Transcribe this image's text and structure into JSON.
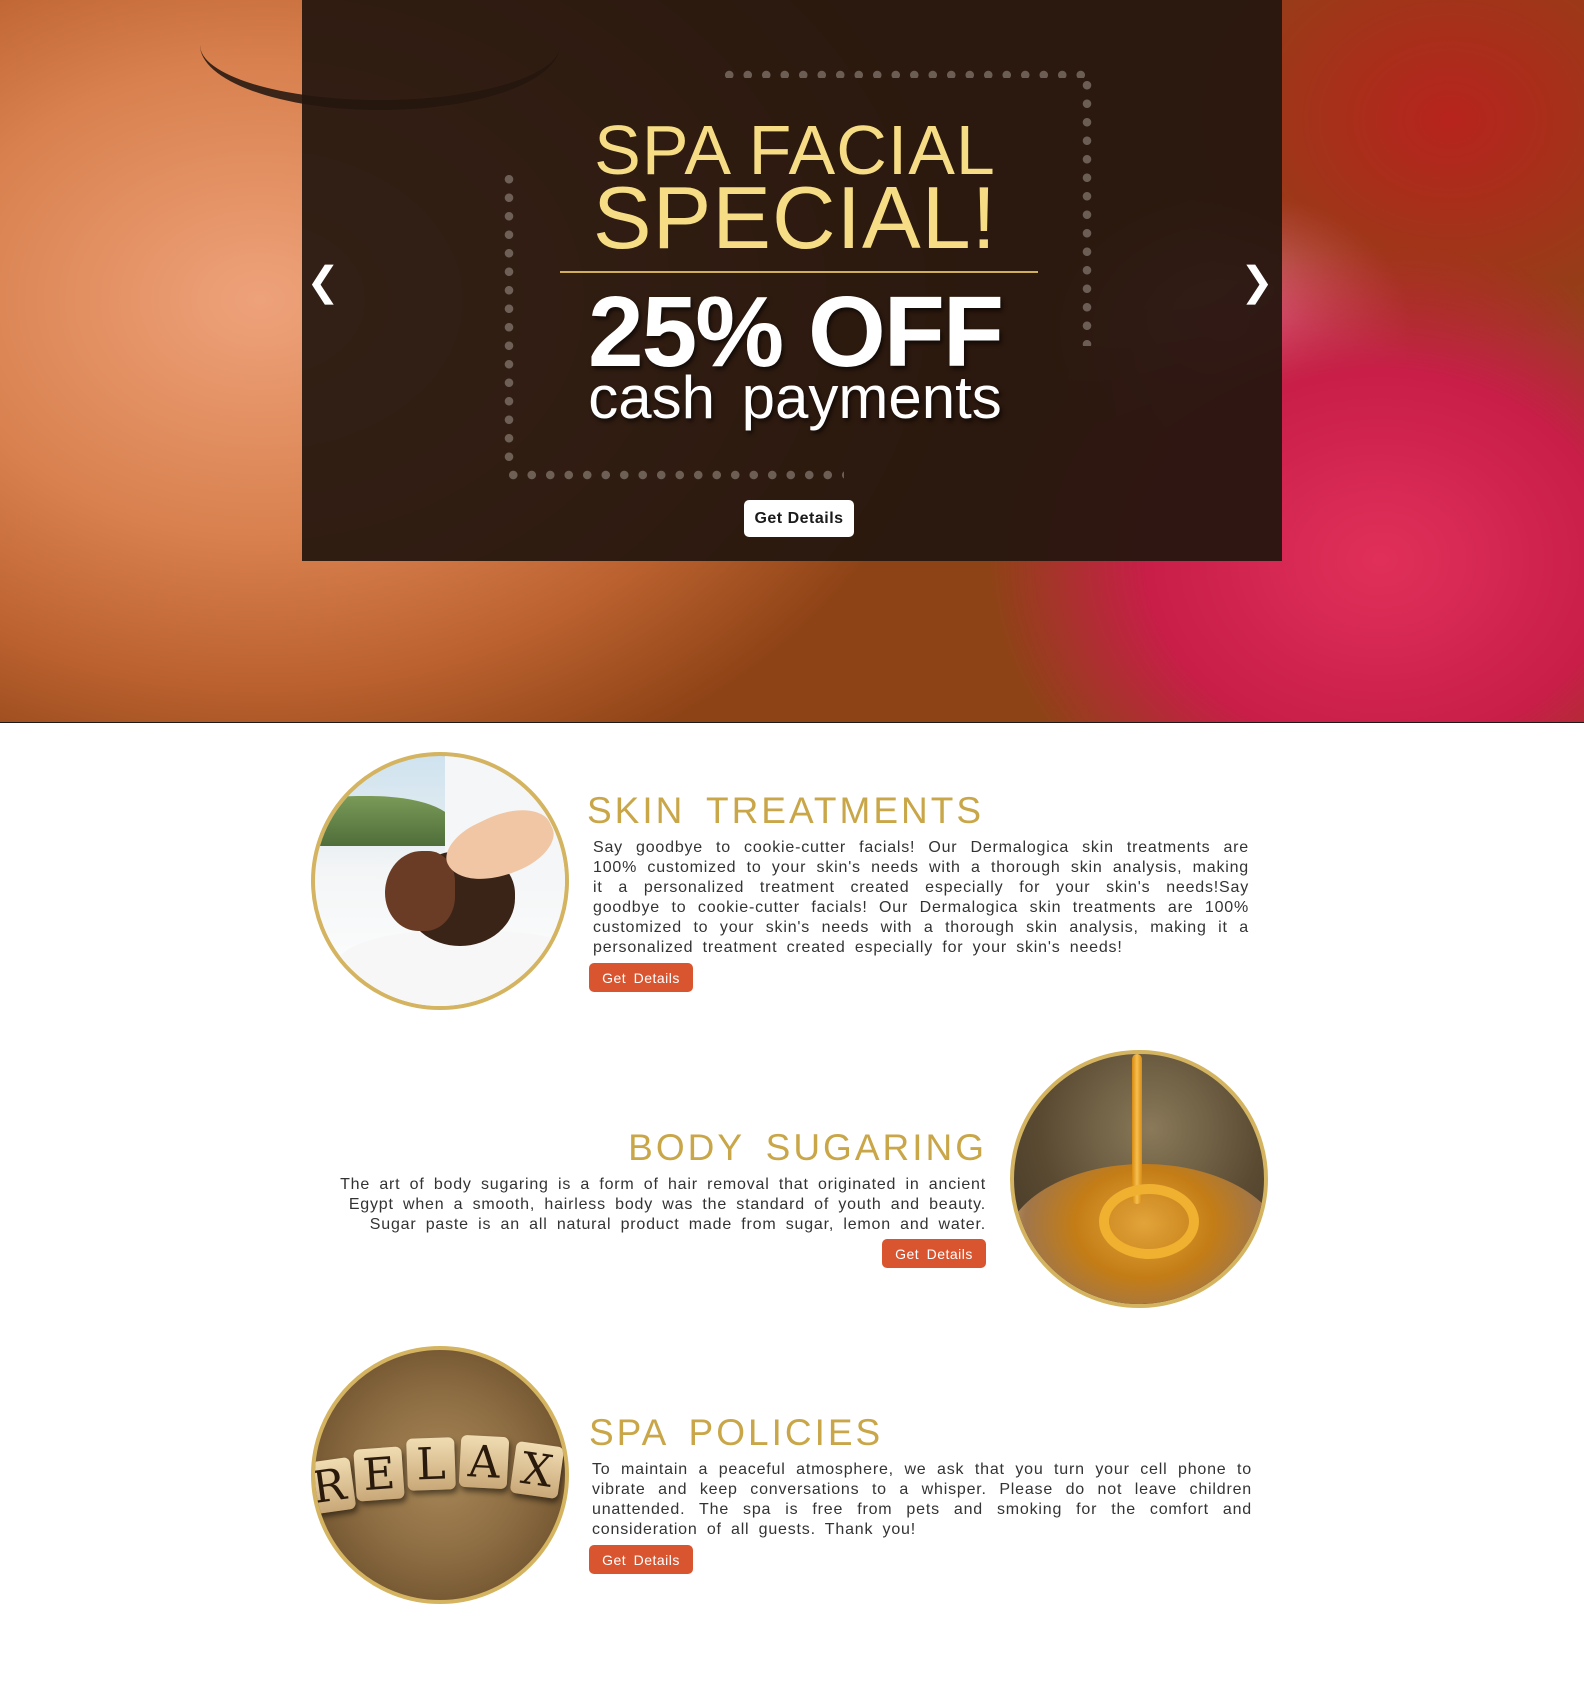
{
  "hero": {
    "title_line1": "SPA FACIAL",
    "title_line2": "SPECIAL!",
    "discount": "25% OFF",
    "discount_note": "cash payments",
    "cta_label": "Get Details",
    "prev_icon": "chevron-left-icon",
    "next_icon": "chevron-right-icon",
    "prev_glyph": "❮",
    "next_glyph": "❯"
  },
  "services": [
    {
      "title": "SKIN TREATMENTS",
      "body": "Say goodbye to cookie-cutter facials! Our Dermalogica skin treatments are 100% customized to your skin's needs with a thorough skin analysis, making it a personalized treatment created especially for your skin's needs!Say goodbye to cookie-cutter facials! Our Dermalogica skin treatments are 100% customized to your skin's needs with a thorough skin analysis, making it a personalized treatment created especially for your skin's needs!",
      "button_label": "Get Details"
    },
    {
      "title": "BODY SUGARING",
      "body": "The art of body sugaring is a form of hair removal that originated in ancient Egypt when a smooth, hairless body was the standard of youth and beauty. Sugar paste is an all natural product made from sugar, lemon and water.",
      "button_label": "Get Details"
    },
    {
      "title": "SPA POLICIES",
      "body": "To maintain a peaceful atmosphere, we ask that you turn your cell phone to vibrate and keep conversations to a whisper.  Please do not leave children unattended.  The spa is free from pets and smoking for the comfort and consideration of all guests. Thank you!",
      "button_label": "Get Details",
      "image_blocks": [
        "R",
        "E",
        "L",
        "A",
        "X"
      ]
    }
  ],
  "colors": {
    "gold": "#c9a648",
    "button": "#d9552f",
    "panel": "#24160e"
  }
}
